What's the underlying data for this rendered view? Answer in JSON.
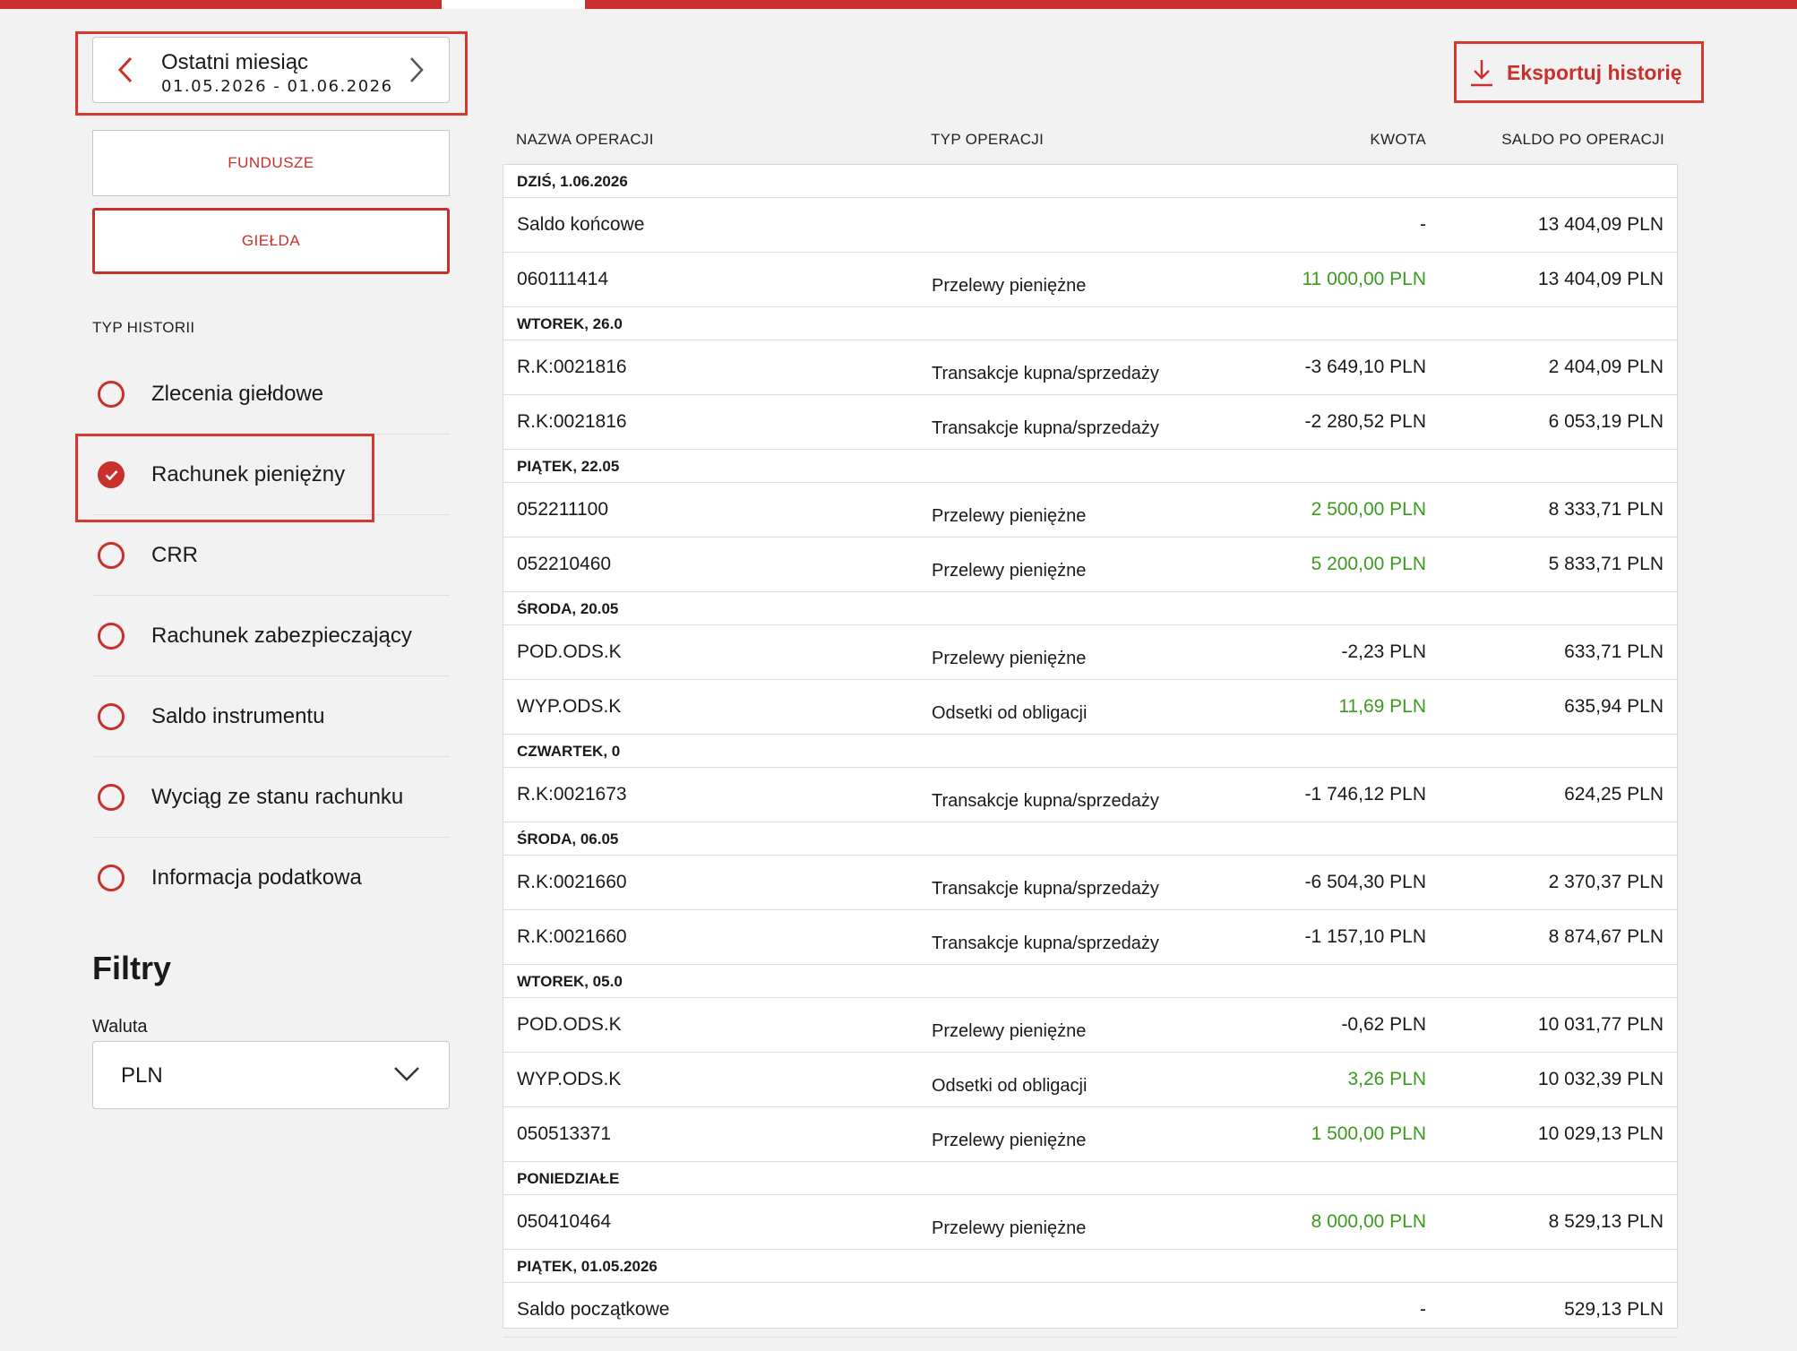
{
  "period": {
    "title": "Ostatni miesiąc",
    "dates": "01.05.2026 - 01.06.2026"
  },
  "modes": {
    "funds": "FUNDUSZE",
    "stock": "GIEŁDA"
  },
  "history_type": {
    "label": "TYP HISTORII",
    "items": [
      {
        "label": "Zlecenia giełdowe",
        "checked": false
      },
      {
        "label": "Rachunek pieniężny",
        "checked": true
      },
      {
        "label": "CRR",
        "checked": false
      },
      {
        "label": "Rachunek zabezpieczający",
        "checked": false
      },
      {
        "label": "Saldo instrumentu",
        "checked": false
      },
      {
        "label": "Wyciąg ze stanu rachunku",
        "checked": false
      },
      {
        "label": "Informacja podatkowa",
        "checked": false
      }
    ]
  },
  "filters": {
    "title": "Filtry",
    "currency_label": "Waluta",
    "currency_value": "PLN"
  },
  "export": {
    "label": "Eksportuj historię"
  },
  "table": {
    "headers": [
      "NAZWA OPERACJI",
      "TYP OPERACJI",
      "KWOTA",
      "SALDO PO OPERACJI"
    ],
    "rows": [
      {
        "kind": "date",
        "label": "DZIŚ, 1.06.2026"
      },
      {
        "kind": "data",
        "name": "Saldo końcowe",
        "type": "",
        "amount": "-",
        "positive": false,
        "balance": "13 404,09 PLN"
      },
      {
        "kind": "data",
        "name": "060111414",
        "type": "Przelewy pieniężne",
        "amount": "11 000,00 PLN",
        "positive": true,
        "balance": "13 404,09 PLN"
      },
      {
        "kind": "date",
        "label": "WTOREK, 26.0"
      },
      {
        "kind": "data",
        "name": "R.K:0021816",
        "type": "Transakcje kupna/sprzedaży",
        "amount": "-3 649,10 PLN",
        "positive": false,
        "balance": "2 404,09 PLN"
      },
      {
        "kind": "data",
        "name": "R.K:0021816",
        "type": "Transakcje kupna/sprzedaży",
        "amount": "-2 280,52 PLN",
        "positive": false,
        "balance": "6 053,19 PLN"
      },
      {
        "kind": "date",
        "label": "PIĄTEK, 22.05"
      },
      {
        "kind": "data",
        "name": "052211100",
        "type": "Przelewy pieniężne",
        "amount": "2 500,00 PLN",
        "positive": true,
        "balance": "8 333,71 PLN"
      },
      {
        "kind": "data",
        "name": "052210460",
        "type": "Przelewy pieniężne",
        "amount": "5 200,00 PLN",
        "positive": true,
        "balance": "5 833,71 PLN"
      },
      {
        "kind": "date",
        "label": "ŚRODA, 20.05"
      },
      {
        "kind": "data",
        "name": "POD.ODS.K",
        "type": "Przelewy pieniężne",
        "amount": "-2,23 PLN",
        "positive": false,
        "balance": "633,71 PLN"
      },
      {
        "kind": "data",
        "name": "WYP.ODS.K",
        "type": "Odsetki od obligacji",
        "amount": "11,69 PLN",
        "positive": true,
        "balance": "635,94 PLN"
      },
      {
        "kind": "date",
        "label": "CZWARTEK, 0"
      },
      {
        "kind": "data",
        "name": "R.K:0021673",
        "type": "Transakcje kupna/sprzedaży",
        "amount": "-1 746,12 PLN",
        "positive": false,
        "balance": "624,25 PLN"
      },
      {
        "kind": "date",
        "label": "ŚRODA, 06.05"
      },
      {
        "kind": "data",
        "name": "R.K:0021660",
        "type": "Transakcje kupna/sprzedaży",
        "amount": "-6 504,30 PLN",
        "positive": false,
        "balance": "2 370,37 PLN"
      },
      {
        "kind": "data",
        "name": "R.K:0021660",
        "type": "Transakcje kupna/sprzedaży",
        "amount": "-1 157,10 PLN",
        "positive": false,
        "balance": "8 874,67 PLN"
      },
      {
        "kind": "date",
        "label": "WTOREK, 05.0"
      },
      {
        "kind": "data",
        "name": "POD.ODS.K",
        "type": "Przelewy pieniężne",
        "amount": "-0,62 PLN",
        "positive": false,
        "balance": "10 031,77 PLN"
      },
      {
        "kind": "data",
        "name": "WYP.ODS.K",
        "type": "Odsetki od obligacji",
        "amount": "3,26 PLN",
        "positive": true,
        "balance": "10 032,39 PLN"
      },
      {
        "kind": "data",
        "name": "050513371",
        "type": "Przelewy pieniężne",
        "amount": "1 500,00 PLN",
        "positive": true,
        "balance": "10 029,13 PLN"
      },
      {
        "kind": "date",
        "label": "PONIEDZIAŁE"
      },
      {
        "kind": "data",
        "name": "050410464",
        "type": "Przelewy pieniężne",
        "amount": "8 000,00 PLN",
        "positive": true,
        "balance": "8 529,13 PLN"
      },
      {
        "kind": "date",
        "label": "PIĄTEK, 01.05.2026"
      },
      {
        "kind": "data",
        "name": "Saldo początkowe",
        "type": "",
        "amount": "-",
        "positive": false,
        "balance": "529,13 PLN"
      }
    ]
  },
  "colors": {
    "accent": "#c9302c",
    "positive": "#3c9a1e"
  },
  "icons": {
    "prev": "chevron-left-icon",
    "next": "chevron-right-icon",
    "export": "download-icon",
    "dropdown": "chevron-down-icon",
    "check": "check-icon"
  }
}
